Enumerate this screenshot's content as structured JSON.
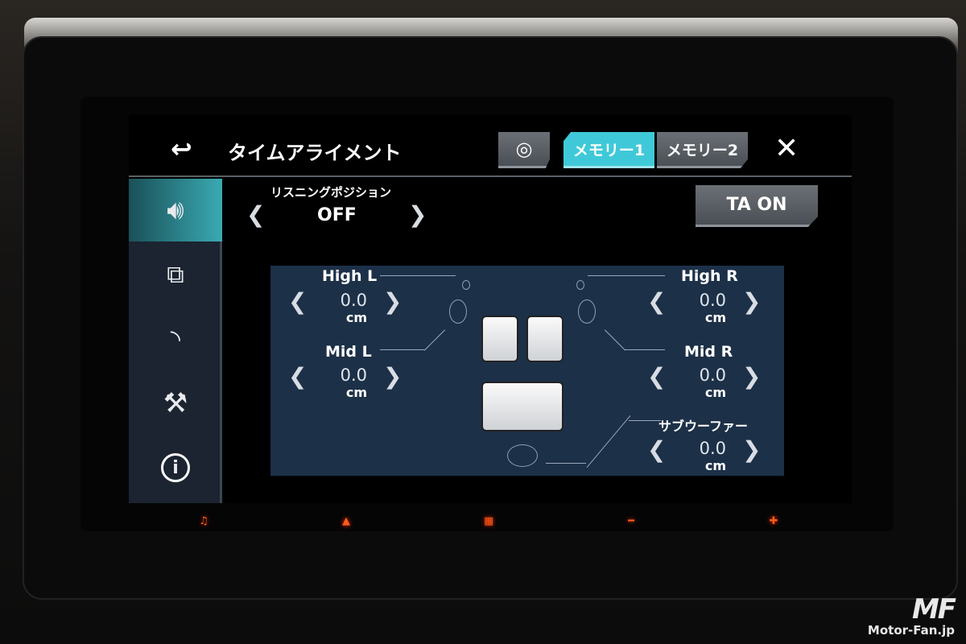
{
  "header": {
    "title": "タイムアライメント",
    "back_icon": "back-arrow-icon",
    "speaker_pos_icon": "speaker-position-icon",
    "memory1": "メモリー1",
    "memory2": "メモリー2",
    "close_icon": "close-icon"
  },
  "listening": {
    "label": "リスニングポジション",
    "value": "OFF"
  },
  "ta_button": "TA ON",
  "sidebar": {
    "items": [
      {
        "icon": "speaker-volume-icon",
        "active": true
      },
      {
        "icon": "source-devices-icon"
      },
      {
        "icon": "wireless-icon"
      },
      {
        "icon": "tools-icon"
      },
      {
        "icon": "info-icon"
      }
    ]
  },
  "channels": {
    "high_l": {
      "label": "High L",
      "value": "0.0",
      "unit": "cm"
    },
    "high_r": {
      "label": "High R",
      "value": "0.0",
      "unit": "cm"
    },
    "mid_l": {
      "label": "Mid L",
      "value": "0.0",
      "unit": "cm"
    },
    "mid_r": {
      "label": "Mid R",
      "value": "0.0",
      "unit": "cm"
    },
    "sub": {
      "label": "サブウーファー",
      "value": "0.0",
      "unit": "cm"
    }
  },
  "hardware_buttons": [
    "music-icon",
    "eject-icon",
    "menu-grid-icon",
    "minus-icon",
    "plus-icon"
  ],
  "watermark": "Motor-Fan.jp",
  "colors": {
    "accent": "#3fc9d8",
    "panel": "#1c3048",
    "hw_led": "#ff5a1a"
  }
}
